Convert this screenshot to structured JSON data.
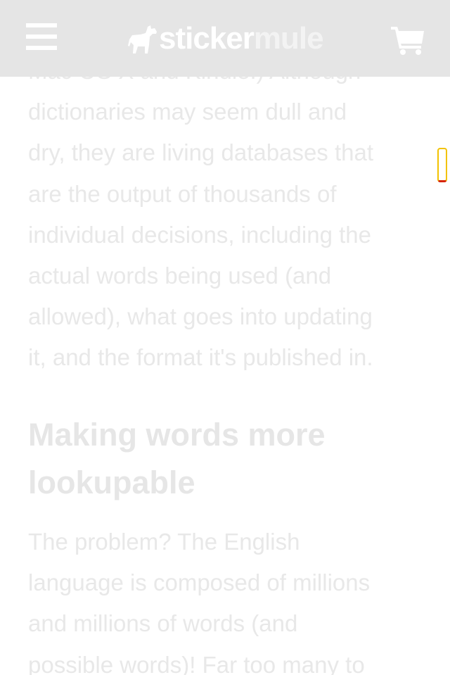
{
  "header": {
    "logo_part1": "sticker",
    "logo_part2": "mule",
    "menu_icon": "hamburger-menu-icon",
    "logo_icon": "mule-logo-icon",
    "cart_icon": "shopping-cart-icon"
  },
  "article": {
    "paragraph_1_lines": [
      "Mac OS X and Kindle.) Although",
      "dictionaries may seem dull and",
      "dry, they are living databases that",
      "are the output of thousands of",
      "individual decisions, including the",
      "actual words being used (and",
      "allowed), what goes into updating",
      "it, and the format it's published in."
    ],
    "heading_lines": [
      "Making words more",
      "lookupable"
    ],
    "paragraph_2_lines": [
      "The problem? The English",
      "language is composed of millions",
      "and millions of words (and",
      "possible words)! Far too many to"
    ]
  },
  "colors": {
    "header_bg": "#e5e5e5",
    "text": "#e8e8e8",
    "scroll_border_top": "#f2c200",
    "scroll_border_bottom": "#d62400"
  }
}
